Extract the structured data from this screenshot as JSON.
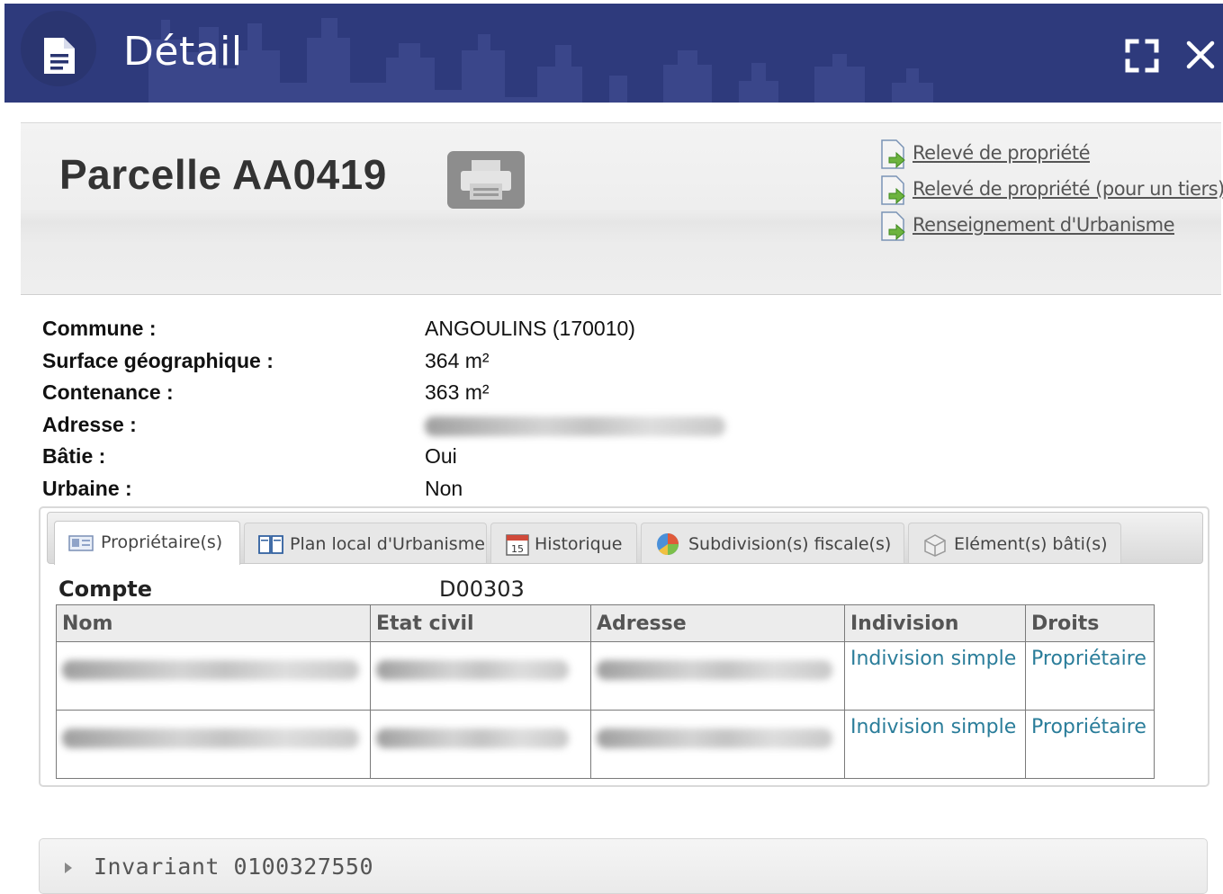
{
  "window": {
    "title": "Détail",
    "header_color": "#2e3a7c",
    "icons": [
      "document-icon",
      "expand-icon",
      "close-icon"
    ]
  },
  "parcel": {
    "title": "Parcelle AA0419",
    "print_icon": "printer-icon",
    "links": [
      {
        "label": "Relevé de propriété",
        "icon": "export-document-icon"
      },
      {
        "label": "Relevé de propriété (pour un tiers)",
        "icon": "export-document-icon"
      },
      {
        "label": "Renseignement d'Urbanisme",
        "icon": "export-document-icon"
      }
    ]
  },
  "info": [
    {
      "label": "Commune :",
      "value": "ANGOULINS (170010)"
    },
    {
      "label": "Surface géographique :",
      "value": "364 m²"
    },
    {
      "label": "Contenance :",
      "value": "363 m²"
    },
    {
      "label": "Adresse :",
      "value": ""
    },
    {
      "label": "Bâtie :",
      "value": "Oui"
    },
    {
      "label": "Urbaine :",
      "value": "Non"
    }
  ],
  "tabs": [
    {
      "label": "Propriétaire(s)",
      "icon": "id-card-icon",
      "active": true
    },
    {
      "label": "Plan local d'Urbanisme",
      "icon": "book-icon",
      "active": false
    },
    {
      "label": "Historique",
      "icon": "calendar-icon",
      "active": false
    },
    {
      "label": "Subdivision(s) fiscale(s)",
      "icon": "pie-chart-icon",
      "active": false
    },
    {
      "label": "Elément(s) bâti(s)",
      "icon": "building-icon",
      "active": false
    }
  ],
  "compte": {
    "label": "Compte",
    "value": "D00303"
  },
  "owners_table": {
    "columns": [
      "Nom",
      "Etat civil",
      "Adresse",
      "Indivision",
      "Droits"
    ],
    "rows": [
      {
        "indivision": "Indivision simple",
        "droits": "Propriétaire"
      },
      {
        "indivision": "Indivision simple",
        "droits": "Propriétaire"
      }
    ]
  },
  "invariant": {
    "label": "Invariant 0100327550"
  }
}
